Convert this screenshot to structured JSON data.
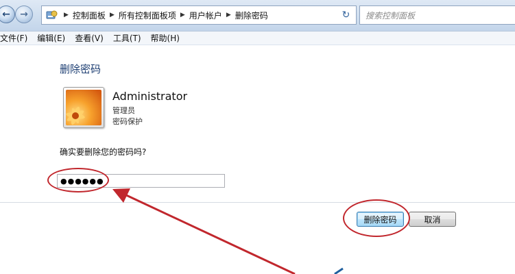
{
  "breadcrumb": {
    "items": [
      "控制面板",
      "所有控制面板项",
      "用户帐户",
      "删除密码"
    ]
  },
  "search": {
    "placeholder": "搜索控制面板"
  },
  "menu": {
    "items": [
      "文件(F)",
      "编辑(E)",
      "查看(V)",
      "工具(T)",
      "帮助(H)"
    ]
  },
  "page": {
    "title": "删除密码",
    "user": {
      "name": "Administrator",
      "role": "管理员",
      "status": "密码保护"
    },
    "question": "确实要删除您的密码吗?",
    "password_value": "●●●●●●"
  },
  "buttons": {
    "delete": "删除密码",
    "cancel": "取消"
  },
  "colors": {
    "annotation": "#c1272d",
    "accent": "#1e3f73"
  },
  "icons": [
    "back-arrow-icon",
    "forward-arrow-icon",
    "control-panel-icon",
    "refresh-icon",
    "chevron-down-icon"
  ]
}
